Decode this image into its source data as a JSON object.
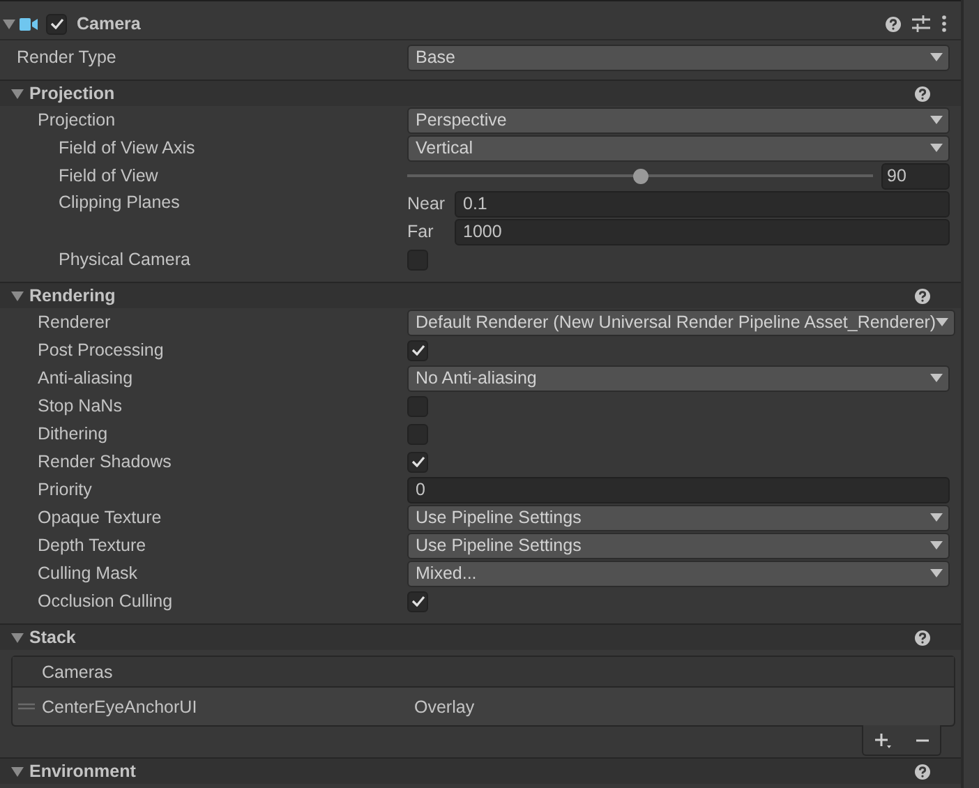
{
  "component": {
    "title": "Camera",
    "enabled": true,
    "expanded": true,
    "render_type": {
      "label": "Render Type",
      "value": "Base"
    }
  },
  "sections": [
    {
      "title": "Projection",
      "expanded": true,
      "rows": [
        {
          "kind": "dropdown",
          "label": "Projection",
          "value": "Perspective",
          "children": [
            {
              "kind": "dropdown",
              "label": "Field of View Axis",
              "value": "Vertical"
            },
            {
              "kind": "slider",
              "label": "Field of View",
              "level": 0.5,
              "value": "90"
            },
            {
              "kind": "clip",
              "label": "Clipping Planes",
              "fields": [
                {
                  "label": "Near",
                  "value": "0.1"
                },
                {
                  "label": "Far",
                  "value": "1000"
                }
              ]
            },
            {
              "kind": "checkbox",
              "label": "Physical Camera",
              "checked": false
            }
          ]
        }
      ]
    },
    {
      "title": "Rendering",
      "expanded": true,
      "rows": [
        {
          "kind": "dropdown",
          "label": "Renderer",
          "value": "Default Renderer (New Universal Render Pipeline Asset_Renderer)"
        },
        {
          "kind": "checkbox",
          "label": "Post Processing",
          "checked": true
        },
        {
          "kind": "dropdown",
          "label": "Anti-aliasing",
          "value": "No Anti-aliasing"
        },
        {
          "kind": "checkbox",
          "label": "Stop NaNs",
          "checked": false
        },
        {
          "kind": "checkbox",
          "label": "Dithering",
          "checked": false
        },
        {
          "kind": "checkbox",
          "label": "Render Shadows",
          "checked": true
        },
        {
          "kind": "text",
          "label": "Priority",
          "value": "0"
        },
        {
          "kind": "dropdown",
          "label": "Opaque Texture",
          "value": "Use Pipeline Settings"
        },
        {
          "kind": "dropdown",
          "label": "Depth Texture",
          "value": "Use Pipeline Settings"
        },
        {
          "kind": "dropdown",
          "label": "Culling Mask",
          "value": "Mixed..."
        },
        {
          "kind": "checkbox",
          "label": "Occlusion Culling",
          "checked": true
        }
      ]
    }
  ],
  "stack": {
    "title": "Stack",
    "expanded": true,
    "list_header": "Cameras",
    "items": [
      {
        "name": "CenterEyeAnchorUI",
        "type": "Overlay"
      }
    ]
  },
  "next_section": {
    "title": "Environment",
    "expanded": true
  }
}
